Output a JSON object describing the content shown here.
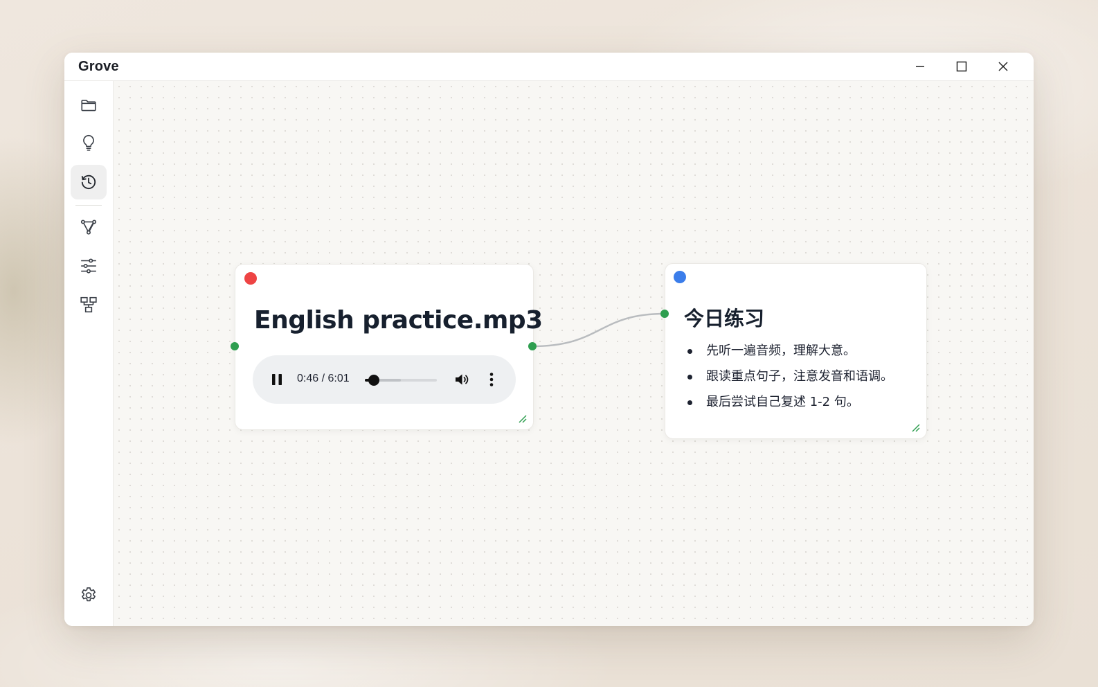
{
  "app": {
    "title": "Grove"
  },
  "window_controls": {
    "minimize_icon": "minimize-icon",
    "maximize_icon": "maximize-icon",
    "close_icon": "close-icon"
  },
  "sidebar": {
    "items": [
      {
        "icon": "folder-icon",
        "active": false
      },
      {
        "icon": "lightbulb-icon",
        "active": false
      },
      {
        "icon": "history-icon",
        "active": true
      },
      {
        "icon": "graph-nodes-icon",
        "active": false
      },
      {
        "icon": "sliders-icon",
        "active": false
      },
      {
        "icon": "hierarchy-icon",
        "active": false
      }
    ],
    "bottom_item": {
      "icon": "settings-gear-icon"
    }
  },
  "canvas": {
    "nodes": [
      {
        "kind": "audio",
        "status_color": "#ee4444",
        "title": "English practice.mp3",
        "player": {
          "state_icon": "pause-icon",
          "time": "0:46 / 6:01",
          "progress_fraction": 0.127,
          "buffered_fraction": 0.5,
          "volume_icon": "volume-icon",
          "more_icon": "more-vertical-icon"
        }
      },
      {
        "kind": "note",
        "status_color": "#3b7dea",
        "title": "今日练习",
        "items": [
          "先听一遍音频，理解大意。",
          "跟读重点句子，注意发音和语调。",
          "最后尝试自己复述 1-2 句。"
        ]
      }
    ],
    "edge_color": "#b9bcbf",
    "port_color": "#2e9e4f"
  }
}
